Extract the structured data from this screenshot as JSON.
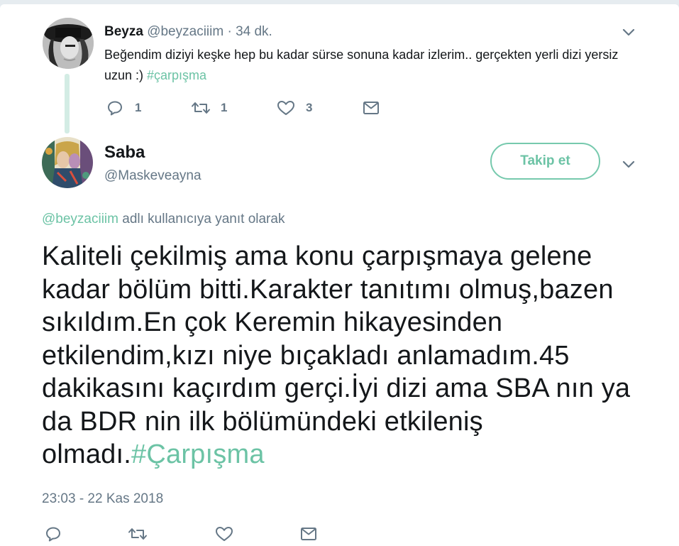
{
  "parent_tweet": {
    "name": "Beyza",
    "handle": "@beyzaciiim",
    "separator": "·",
    "time": "34 dk.",
    "text": "Beğendim diziyi keşke hep bu kadar sürse sonuna kadar izlerim.. gerçekten yerli dizi yersiz uzun :) ",
    "hashtag": "#çarpışma",
    "reply_count": "1",
    "retweet_count": "1",
    "like_count": "3"
  },
  "main_tweet": {
    "name": "Saba",
    "handle": "@Maskeveayna",
    "follow_label": "Takip et",
    "reply_mention": "@beyzaciiim",
    "reply_context": " adlı kullanıcıya yanıt olarak",
    "text": "Kaliteli çekilmiş ama konu çarpışmaya gelene kadar bölüm bitti.Karakter tanıtımı olmuş,bazen sıkıldım.En çok Keremin hikayesinden etkilendim,kızı niye bıçakladı anlamadım.45 dakikasını kaçırdım gerçi.İyi dizi ama SBA nın ya da BDR nin ilk bölümündeki etkileniş olmadı.",
    "hashtag": "#Çarpışma",
    "date": "23:03 - 22 Kas 2018"
  },
  "icons": {
    "reply": "reply-icon",
    "retweet": "retweet-icon",
    "like": "heart-icon",
    "dm": "envelope-icon",
    "more": "chevron-down-icon"
  },
  "colors": {
    "accent": "#6cc3a5",
    "muted": "#657786",
    "text": "#14171a",
    "thread_line": "#d3ece4"
  }
}
